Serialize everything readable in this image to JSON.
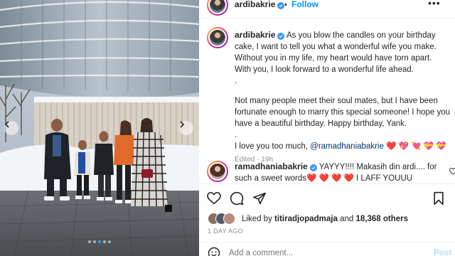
{
  "post": {
    "username": "ardibakrie",
    "follow_label": "Follow",
    "dot": "•",
    "more_label": "•••",
    "caption": {
      "p1": "As you blow the candles on your birthday cake, I want to tell you what a wonderful wife you make. Without you in my life, my heart would have torn apart. With you, I look forward to a wonderful life ahead.",
      "p1_period": ".",
      "p2": "Not many people meet their soul mates, but I have been fortunate enough to marry this special someone! I hope you have a beautiful birthday. Happy birthday, Yank.",
      "p2_period": ".",
      "p3_text": "I love you too much,",
      "p3_mention": "@ramadhaniabakrie",
      "p3_emojis": "❤️ 💖 💘 💝 💝",
      "meta": "Edited · 19h"
    },
    "comment": {
      "username": "ramadhaniabakrie",
      "text": "YAYYY!!!! Makasih din ardi.... for such a sweet words❤️ ❤️ ❤️ ❤️ I LAFF YOUUU"
    },
    "likes": {
      "prefix": "Liked by",
      "user": "titiradjopadmaja",
      "and": "and",
      "count": "18,368 others"
    },
    "date": "1 DAY AGO",
    "add_comment_placeholder": "Add a comment...",
    "post_label": "Post"
  },
  "icons": {
    "like": "heart-icon",
    "comment": "comment-icon",
    "share": "send-icon",
    "save": "bookmark-icon",
    "emoji": "emoji-icon",
    "verified": "verified-badge-icon"
  },
  "carousel": {
    "dot_count": 5,
    "active_index": 2
  },
  "colors": {
    "accent": "#0095f6",
    "verified": "#3897f0",
    "mention": "#00376b",
    "secondary_text": "#8e8e8e"
  }
}
